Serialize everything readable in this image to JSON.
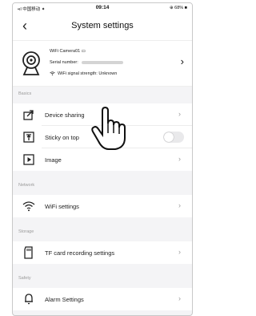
{
  "status_bar": {
    "carrier": "•ıl 中国移动 ✦",
    "time": "09:14",
    "battery": "⊕ 68% ■"
  },
  "header": {
    "back_icon": "‹",
    "title": "System settings"
  },
  "device": {
    "name": "WiFi Camera01 ▭",
    "serial_label": "Serial number:",
    "wifi_label": "WiFi signal strength: Unknown",
    "chevron": "›"
  },
  "sections": {
    "basics": "Basics",
    "network": "Network",
    "storage": "Storage",
    "safety": "Safety"
  },
  "rows": {
    "device_sharing": {
      "label": "Device sharing",
      "chevron": "›"
    },
    "sticky_top": {
      "label": "Sticky on top",
      "toggled": false
    },
    "image": {
      "label": "Image",
      "chevron": "›"
    },
    "wifi_settings": {
      "label": "WiFi settings",
      "chevron": "›"
    },
    "tf_card": {
      "label": "TF card recording settings",
      "chevron": "›"
    },
    "alarm": {
      "label": "Alarm Settings",
      "chevron": "›"
    }
  },
  "colors": {
    "background": "#f4f4f6",
    "row": "#ffffff",
    "section_text": "#9a9a9a",
    "toggle_off": "#e9e9eb"
  }
}
